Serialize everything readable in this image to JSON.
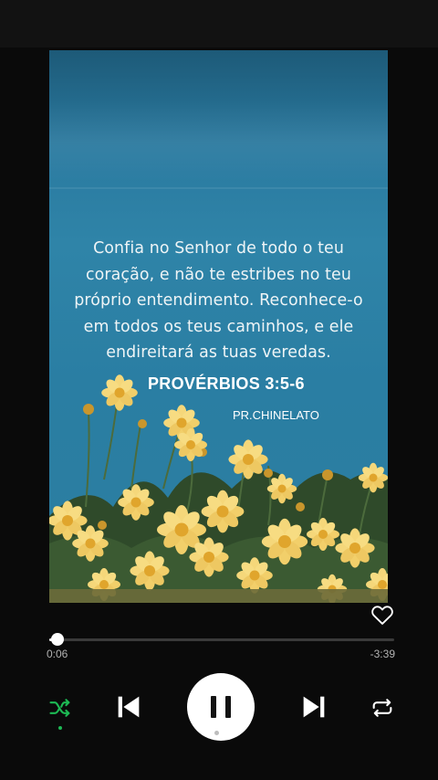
{
  "artwork": {
    "verse_lines": [
      "Confia no Senhor de todo o teu",
      "coração, e não te estribes no teu",
      "próprio entendimento. Reconhece-o",
      "em todos os teus caminhos, e ele",
      "endireitará as tuas veredas."
    ],
    "reference": "PROVÉRBIOS 3:5-6",
    "author": "PR.CHINELATO"
  },
  "player": {
    "like_icon": "heart-outline-icon",
    "progress_fraction": 0.0247,
    "elapsed": "0:06",
    "remaining": "-3:39",
    "shuffle_icon": "shuffle-icon",
    "shuffle_active": true,
    "previous_icon": "skip-previous-icon",
    "play_pause_icon": "pause-icon",
    "next_icon": "skip-next-icon",
    "repeat_icon": "repeat-icon"
  },
  "colors": {
    "accent": "#1db954",
    "background": "#0a0a0a",
    "text_secondary": "#b3b3b3"
  }
}
